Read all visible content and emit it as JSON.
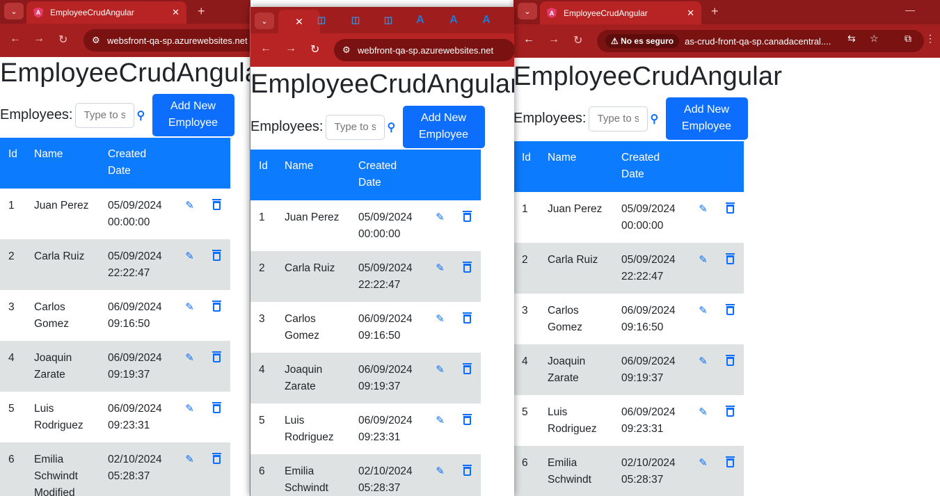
{
  "app": {
    "heading": "EmployeeCrudAngular",
    "employees_label": "Employees:",
    "search_placeholder": "Type to search",
    "add_line1": "Add New",
    "add_line2": "Employee",
    "columns": {
      "id": "Id",
      "name": "Name",
      "created_line1": "Created",
      "created_line2": "Date"
    },
    "rows": [
      {
        "id": "1",
        "name": "Juan Perez",
        "date": "05/09/2024",
        "time": "00:00:00"
      },
      {
        "id": "2",
        "name": "Carla Ruiz",
        "date": "05/09/2024",
        "time": "22:22:47"
      },
      {
        "id": "3",
        "name": "Carlos Gomez",
        "date": "06/09/2024",
        "time": "09:16:50"
      },
      {
        "id": "4",
        "name": "Joaquin Zarate",
        "date": "06/09/2024",
        "time": "09:19:37"
      },
      {
        "id": "5",
        "name": "Luis Rodriguez",
        "date": "06/09/2024",
        "time": "09:23:31"
      },
      {
        "id": "6",
        "name": "Emilia Schwindt",
        "date": "02/10/2024",
        "time": "05:28:37"
      }
    ],
    "row6_extra_win1": "Modified"
  },
  "window1": {
    "tab_title": "EmployeeCrudAngular",
    "url": "websfront-qa-sp.azurewebsites.net"
  },
  "window2": {
    "url": "webfront-qa-sp.azurewebsites.net"
  },
  "window3": {
    "tab_title": "EmployeeCrudAngular",
    "security_chip": "No es seguro",
    "url": "as-crud-front-qa-sp.canadacentral...."
  },
  "colors": {
    "browser_frame": "#8d1a1a",
    "primary": "#0d6efd",
    "table_header": "#0d7bfd",
    "row_alt": "#dee2e3"
  },
  "icons": {
    "edit": "pencil-square-icon",
    "delete": "trash-icon",
    "search": "search-icon"
  }
}
